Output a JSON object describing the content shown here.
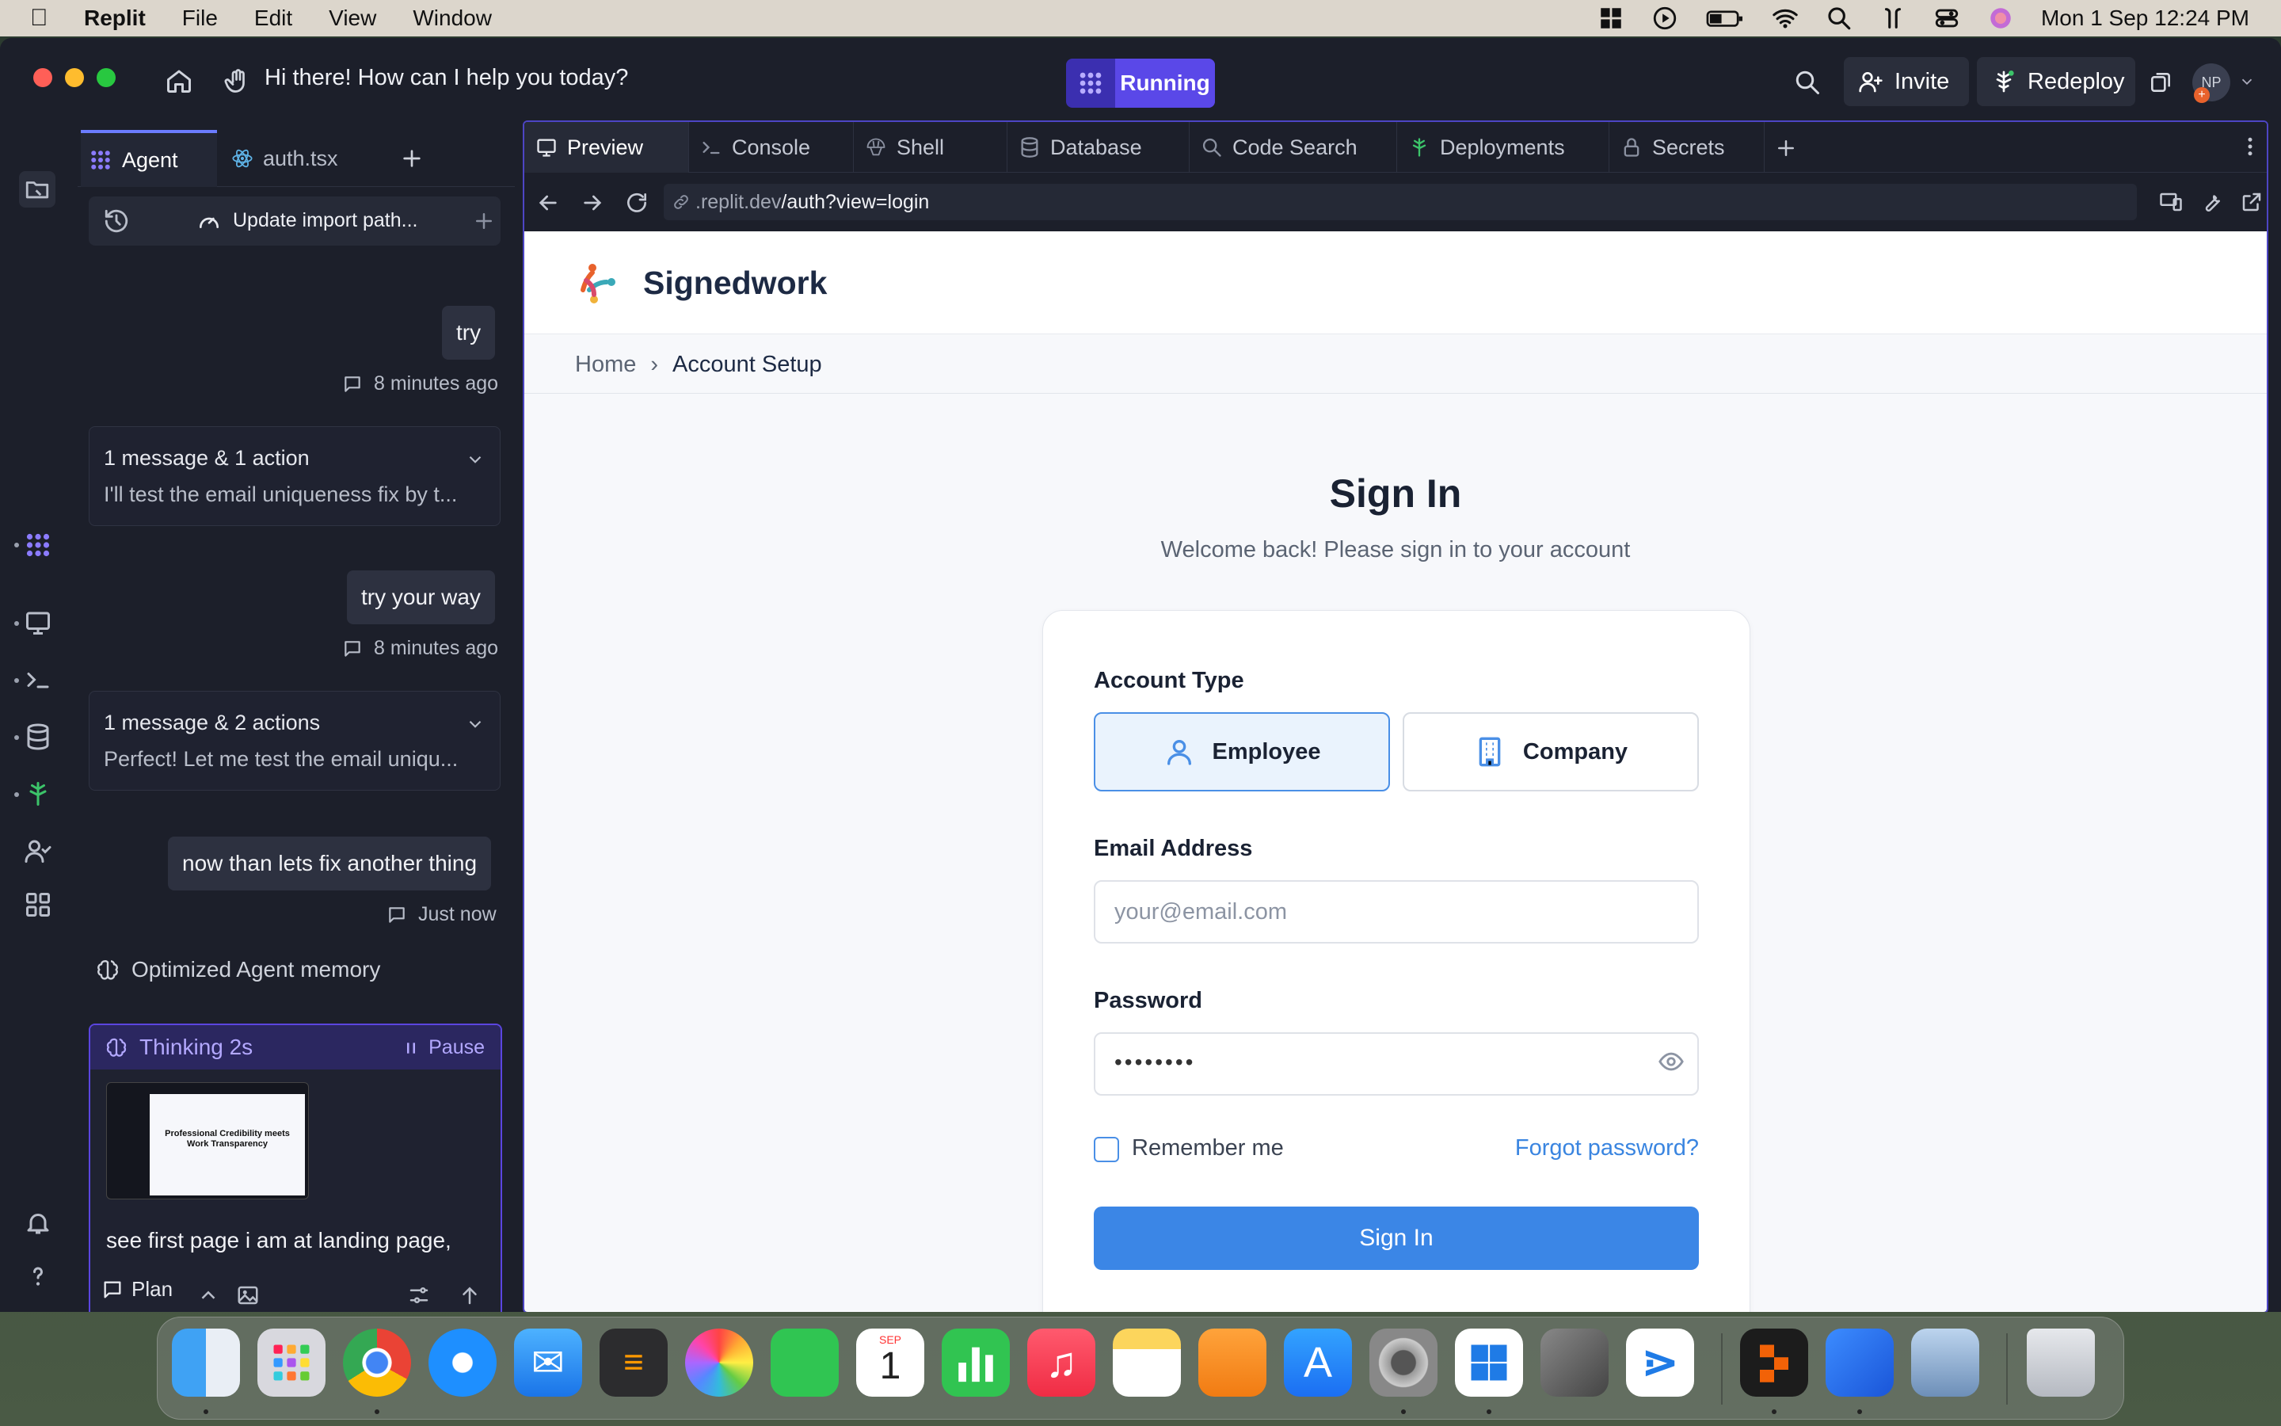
{
  "menubar": {
    "app": "Replit",
    "items": [
      "File",
      "Edit",
      "View",
      "Window"
    ],
    "clock": "Mon 1 Sep  12:24 PM"
  },
  "titlebar": {
    "prompt": "Hi there! How can I help you today?",
    "status": "Running",
    "invite": "Invite",
    "redeploy": "Redeploy",
    "avatar": "NP"
  },
  "agent_panel": {
    "tabs": [
      "Agent",
      "auth.tsx"
    ],
    "header": "Update import path...",
    "messages": [
      {
        "text": "try",
        "time": "8 minutes ago"
      },
      {
        "text": "try your way",
        "time": "8 minutes ago"
      },
      {
        "text": "now than lets fix another thing",
        "time": "Just now"
      }
    ],
    "cards": [
      {
        "title": "1 message & 1 action",
        "summary": "I'll test the email uniqueness fix by t..."
      },
      {
        "title": "1 message & 2 actions",
        "summary": "Perfect! Let me test the email uniqu..."
      }
    ],
    "memory": "Optimized Agent memory",
    "thinking": "Thinking 2s",
    "pause": "Pause",
    "thumb_title": "Professional Credibility meets Work Transparency",
    "input_text": "see first page i am at landing page,",
    "plan": "Plan"
  },
  "preview": {
    "tabs": [
      "Preview",
      "Console",
      "Shell",
      "Database",
      "Code Search",
      "Deployments",
      "Secrets"
    ],
    "url_dim": ".replit.dev",
    "url_main": "/auth?view=login"
  },
  "site": {
    "brand": "Signedwork",
    "crumb_home": "Home",
    "crumb_sep": "›",
    "crumb_current": "Account Setup",
    "title": "Sign In",
    "subtitle": "Welcome back! Please sign in to your account",
    "account_type_label": "Account Type",
    "employee": "Employee",
    "company": "Company",
    "email_label": "Email Address",
    "email_placeholder": "your@email.com",
    "password_label": "Password",
    "password_dots": "••••••••",
    "remember": "Remember me",
    "forgot": "Forgot password?",
    "submit": "Sign In"
  },
  "dock_apps": [
    "Finder",
    "Launchpad",
    "Chrome",
    "Safari",
    "Mail",
    "Calculator",
    "Photos",
    "FaceTime",
    "Calendar",
    "Numbers",
    "Music",
    "Notes",
    "Pages",
    "App Store",
    "System Settings",
    "Windows App",
    "iPhone Mirroring",
    "VS Code",
    "Replit",
    "Remote Desktop",
    "Preview",
    "Trash"
  ],
  "calendar": {
    "month": "SEP",
    "day": "1"
  },
  "colors": {
    "accent": "#5a48e8",
    "primary": "#3b86e6",
    "window_bg": "#1c1f2a"
  }
}
